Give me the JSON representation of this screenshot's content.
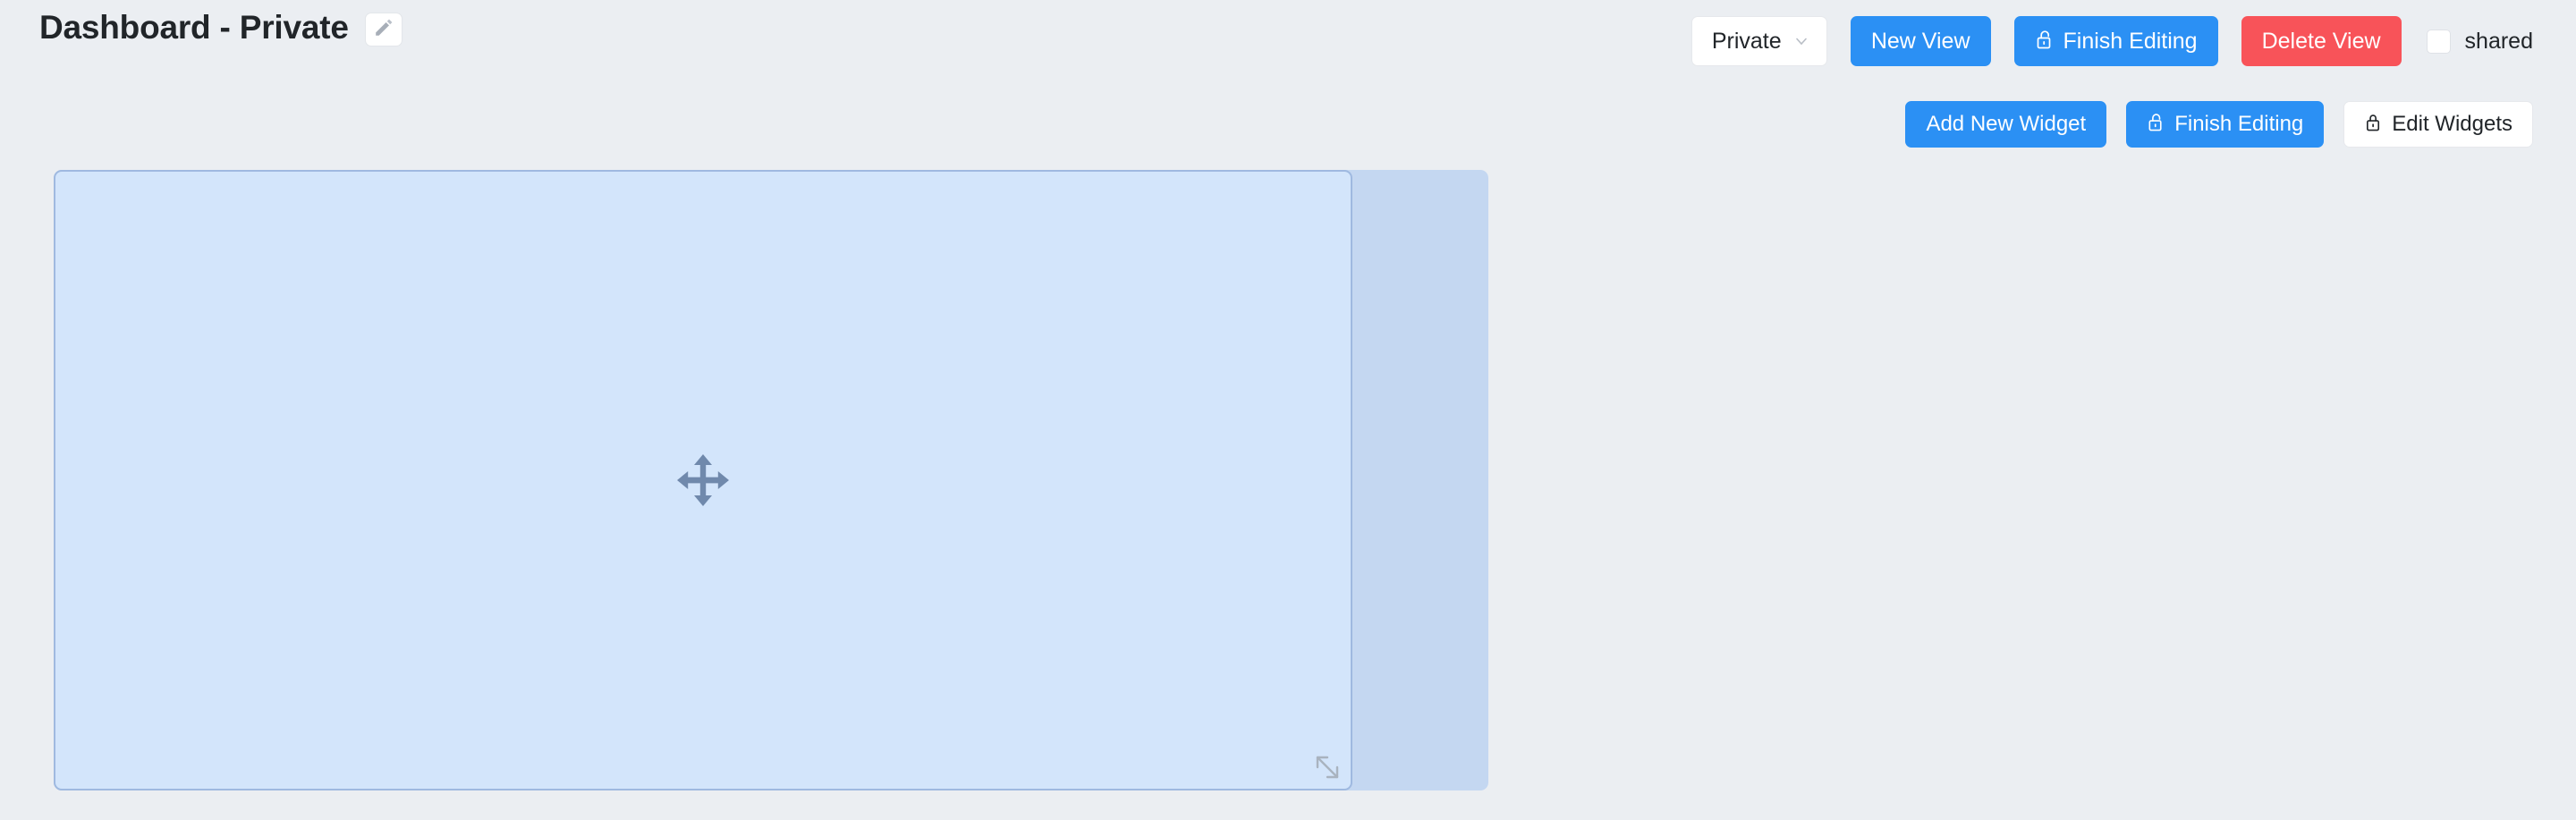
{
  "header": {
    "title": "Dashboard - Private",
    "edit_title_icon": "pencil-icon"
  },
  "controls_row_1": {
    "view_select": {
      "selected": "Private",
      "icon": "chevron-down-icon",
      "options": [
        "Private"
      ]
    },
    "new_view_label": "New View",
    "finish_editing_label": "Finish Editing",
    "finish_editing_icon": "unlock-icon",
    "delete_view_label": "Delete View",
    "shared_label": "shared",
    "shared_checked": false
  },
  "controls_row_2": {
    "add_widget_label": "Add New Widget",
    "finish_editing_label": "Finish Editing",
    "finish_editing_icon": "unlock-icon",
    "edit_widgets_label": "Edit Widgets",
    "edit_widgets_icon": "lock-icon"
  },
  "widget_grid": {
    "move_handle_icon": "move-arrows-icon",
    "resize_handle_icon": "resize-diagonal-icon"
  },
  "colors": {
    "page_background": "#ebeef2",
    "accent_blue": "#2b90f4",
    "danger_red": "#f85359",
    "widget_fill": "#d3e5fb",
    "widget_border": "#9fb9e0",
    "widget_band": "#c4d7f1",
    "handle_gray": "#7089ac",
    "title_text": "#212529",
    "surface_white": "#ffffff"
  }
}
